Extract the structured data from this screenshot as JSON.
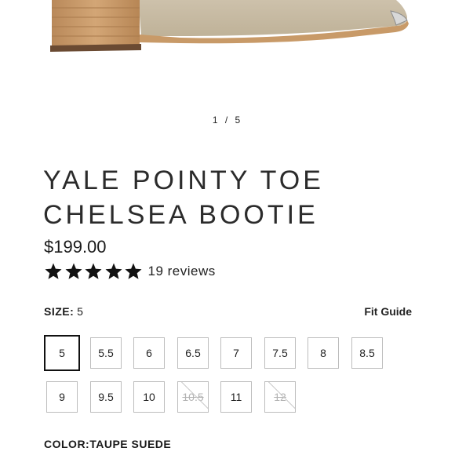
{
  "gallery": {
    "pager_text": "1 / 5"
  },
  "product": {
    "title_line1": "YALE POINTY TOE",
    "title_line2": "CHELSEA BOOTIE",
    "price": "$199.00",
    "rating_value": 5,
    "rating_max": 5,
    "reviews_text": "19 reviews"
  },
  "size_section": {
    "label": "SIZE:",
    "selected_value": "5",
    "fit_guide_label": "Fit Guide",
    "sizes": [
      {
        "label": "5",
        "state": "selected"
      },
      {
        "label": "5.5",
        "state": "available"
      },
      {
        "label": "6",
        "state": "available"
      },
      {
        "label": "6.5",
        "state": "available"
      },
      {
        "label": "7",
        "state": "available"
      },
      {
        "label": "7.5",
        "state": "available"
      },
      {
        "label": "8",
        "state": "available"
      },
      {
        "label": "8.5",
        "state": "available"
      },
      {
        "label": "9",
        "state": "available"
      },
      {
        "label": "9.5",
        "state": "available"
      },
      {
        "label": "10",
        "state": "available"
      },
      {
        "label": "10.5",
        "state": "unavailable"
      },
      {
        "label": "11",
        "state": "available"
      },
      {
        "label": "12",
        "state": "unavailable"
      }
    ]
  },
  "color_section": {
    "label": "COLOR:",
    "value": "TAUPE SUEDE"
  },
  "colors": {
    "suede": "#c9bca6",
    "sole": "#c89a68",
    "text": "#2b2b2b"
  }
}
